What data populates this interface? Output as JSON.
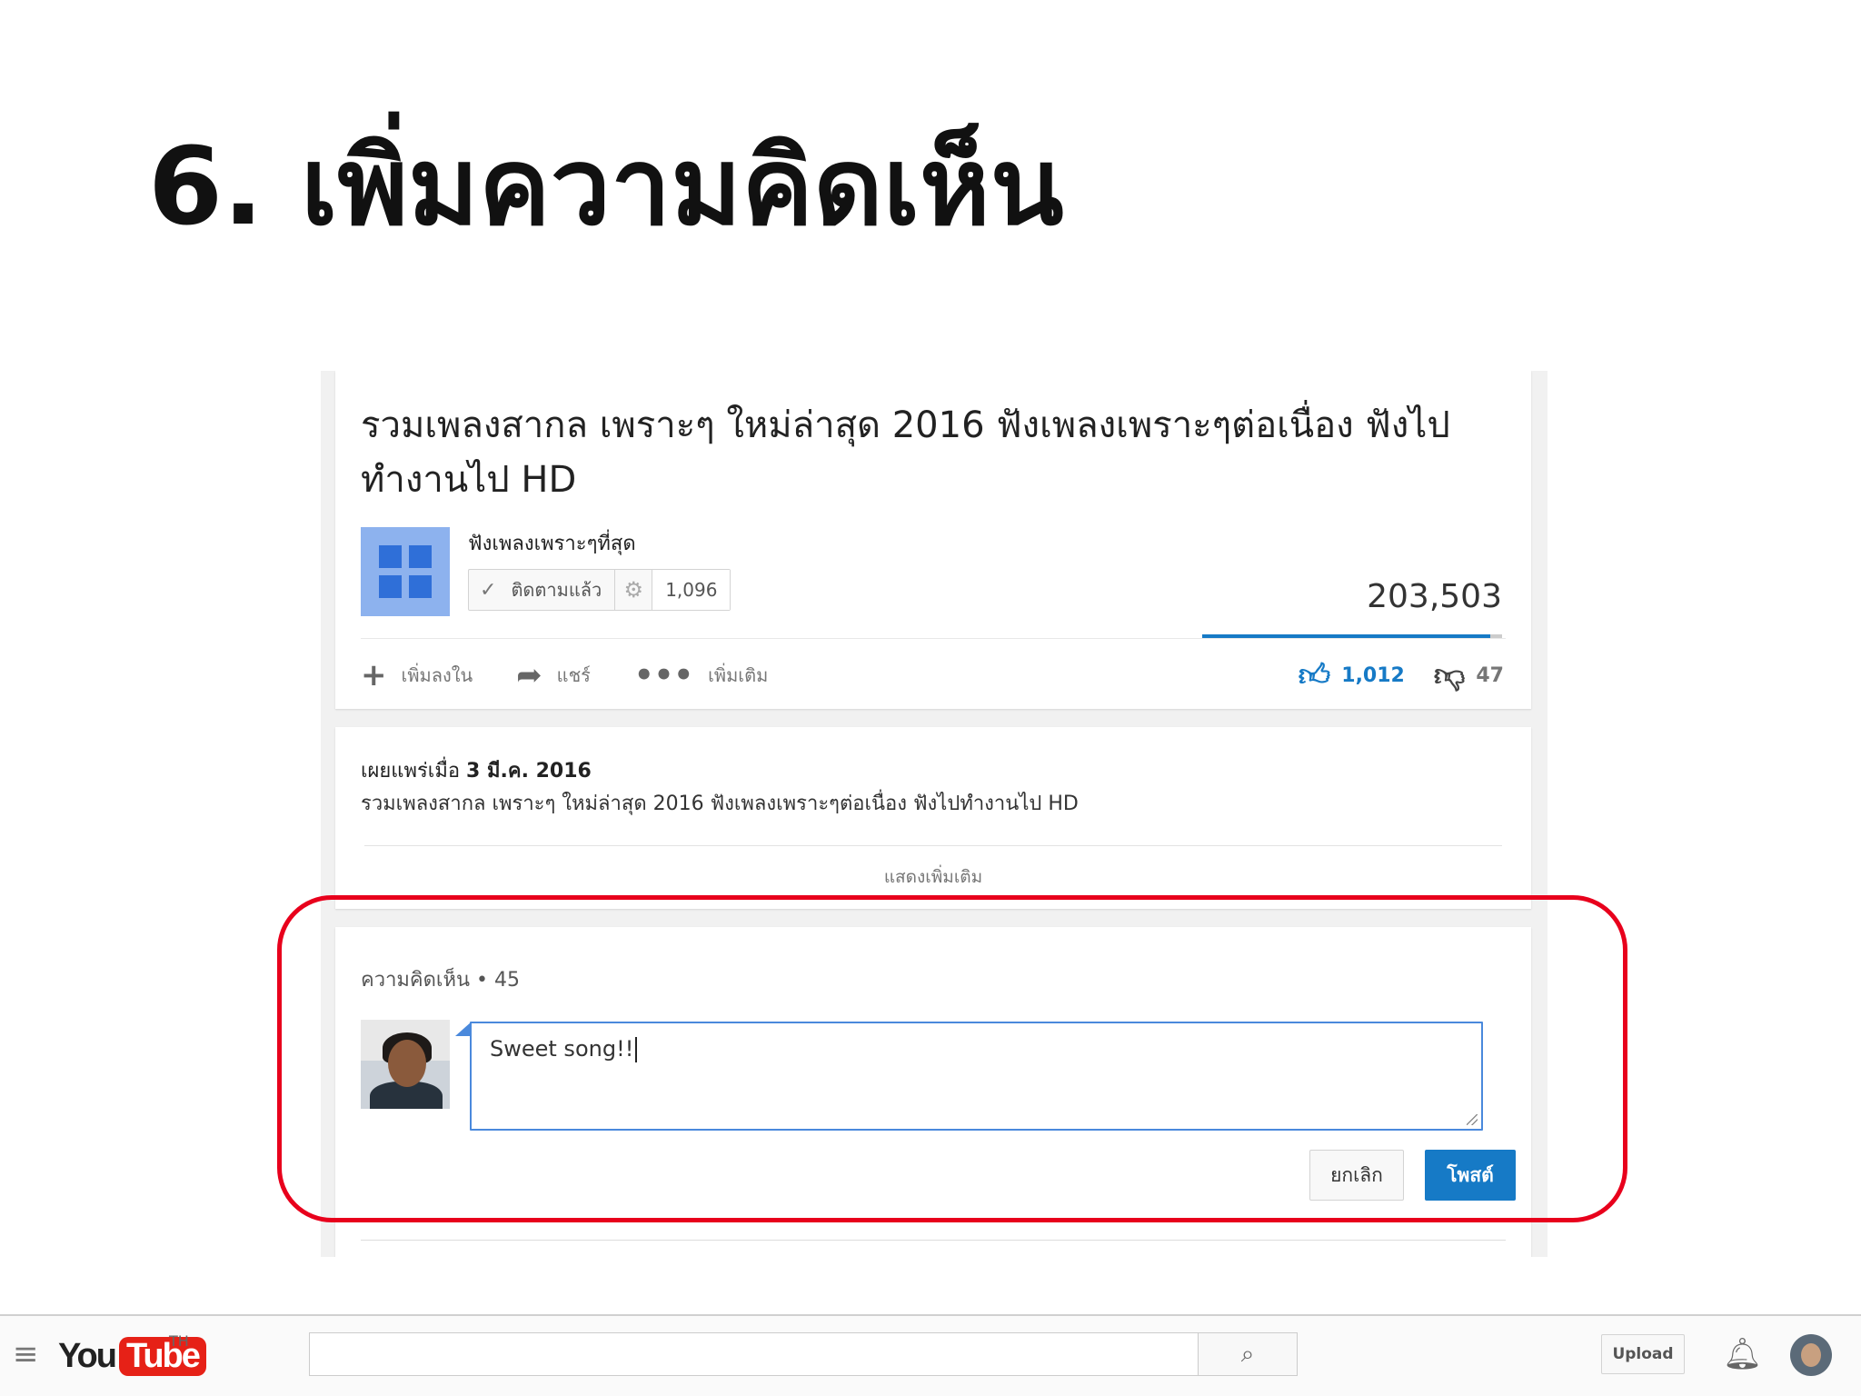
{
  "slide": {
    "title": "6. เพิ่มความคิดเห็น"
  },
  "video": {
    "title": "รวมเพลงสากล เพราะๆ ใหม่ล่าสุด 2016 ฟังเพลงเพราะๆต่อเนื่อง ฟังไปทำงานไป HD",
    "channel_name": "ฟังเพลงเพราะๆที่สุด",
    "subscribe_label": "ติดตามแล้ว",
    "subscriber_count": "1,096",
    "view_count": "203,503",
    "like_ratio": 0.96,
    "actions": {
      "add_to": "เพิ่มลงใน",
      "share": "แชร์",
      "more": "เพิ่มเติม"
    },
    "like_count": "1,012",
    "dislike_count": "47"
  },
  "description": {
    "published_prefix": "เผยแพร่เมื่อ",
    "published_date": "3 มี.ค. 2016",
    "text": "รวมเพลงสากล เพราะๆ ใหม่ล่าสุด 2016 ฟังเพลงเพราะๆต่อเนื่อง ฟังไปทำงานไป HD",
    "show_more": "แสดงเพิ่มเติม"
  },
  "comments": {
    "header": "ความคิดเห็น • 45",
    "input_value": "Sweet song!!",
    "cancel_label": "ยกเลิก",
    "post_label": "โพสต์"
  },
  "masthead": {
    "logo_you": "You",
    "logo_tube": "Tube",
    "country_code": "TH",
    "upload_label": "Upload"
  },
  "colors": {
    "accent": "#167ac6",
    "highlight": "#e8001c",
    "youtube_red": "#e62117"
  },
  "icons": {
    "menu": "hamburger-icon",
    "search": "search-icon",
    "bell": "bell-icon",
    "add": "plus-icon",
    "share": "share-arrow-icon",
    "more": "ellipsis-icon",
    "like": "thumbs-up-icon",
    "dislike": "thumbs-down-icon",
    "check": "check-icon",
    "gear": "gear-icon"
  }
}
